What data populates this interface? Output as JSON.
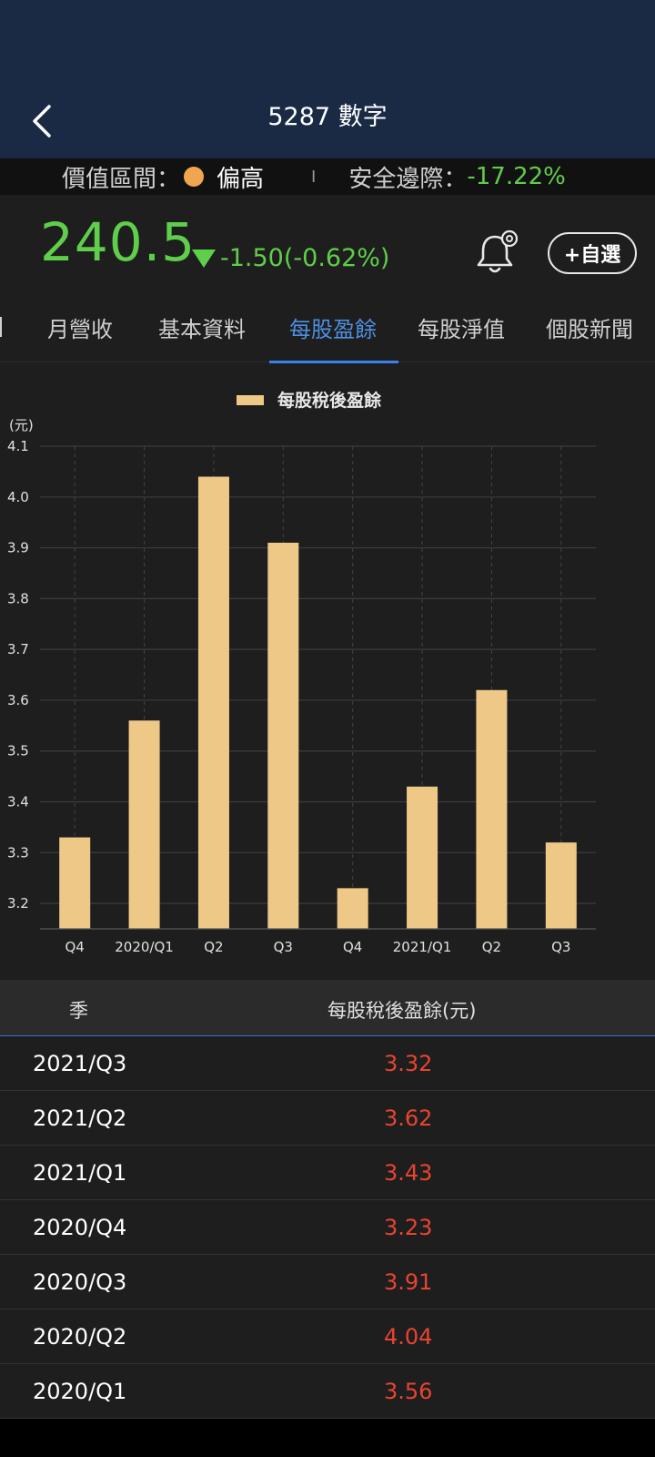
{
  "header": {
    "title": "5287 數字"
  },
  "value_strip": {
    "range_label": "價值區間：",
    "range_level": "偏高",
    "divider": "I",
    "margin_label": "安全邊際：",
    "margin_value": "-17.22%",
    "dot_color": "#f0a650"
  },
  "quote": {
    "price": "240.5",
    "change": "-1.50(-0.62%)",
    "watch_label": "+自選",
    "color": "#5fce4a"
  },
  "tabs": [
    {
      "label": "月營收",
      "active": false
    },
    {
      "label": "基本資料",
      "active": false
    },
    {
      "label": "每股盈餘",
      "active": true
    },
    {
      "label": "每股淨值",
      "active": false
    },
    {
      "label": "個股新聞",
      "active": false
    }
  ],
  "chart_data": {
    "type": "bar",
    "legend": "每股稅後盈餘",
    "legend_position": "top-center",
    "ylabel": "(元)",
    "categories": [
      "Q4",
      "2020/Q1",
      "Q2",
      "Q3",
      "Q4",
      "2021/Q1",
      "Q2",
      "Q3"
    ],
    "values": [
      3.33,
      3.56,
      4.04,
      3.91,
      3.23,
      3.43,
      3.62,
      3.32
    ],
    "y_ticks": [
      "4.1",
      "4.0",
      "3.9",
      "3.8",
      "3.7",
      "3.6",
      "3.5",
      "3.4",
      "3.3",
      "3.2"
    ],
    "ylim": [
      3.15,
      4.1
    ],
    "grid": true,
    "bar_color": "#eec887"
  },
  "table": {
    "headers": {
      "season": "季",
      "eps": "每股稅後盈餘(元)"
    },
    "rows": [
      {
        "season": "2021/Q3",
        "eps": "3.32"
      },
      {
        "season": "2021/Q2",
        "eps": "3.62"
      },
      {
        "season": "2021/Q1",
        "eps": "3.43"
      },
      {
        "season": "2020/Q4",
        "eps": "3.23"
      },
      {
        "season": "2020/Q3",
        "eps": "3.91"
      },
      {
        "season": "2020/Q2",
        "eps": "4.04"
      },
      {
        "season": "2020/Q1",
        "eps": "3.56"
      }
    ]
  }
}
